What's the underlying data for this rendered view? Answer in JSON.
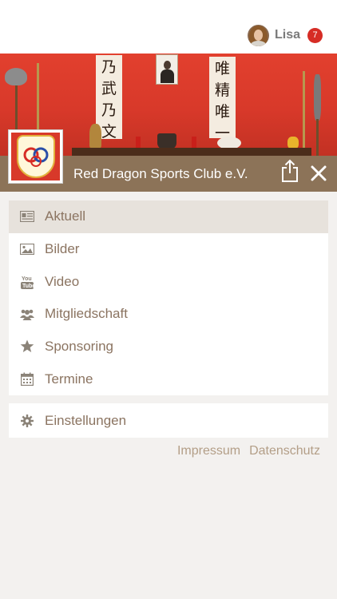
{
  "user": {
    "name": "Lisa",
    "notification_count": "7"
  },
  "hero": {
    "scroll_left": [
      "乃",
      "武",
      "乃",
      "文"
    ],
    "scroll_right": [
      "唯",
      "精",
      "唯",
      "一"
    ]
  },
  "club": {
    "title": "Red Dragon Sports Club e.V."
  },
  "menu": {
    "items": [
      {
        "label": "Aktuell",
        "icon": "newspaper-icon",
        "active": true
      },
      {
        "label": "Bilder",
        "icon": "image-icon",
        "active": false
      },
      {
        "label": "Video",
        "icon": "youtube-icon",
        "active": false
      },
      {
        "label": "Mitgliedschaft",
        "icon": "users-icon",
        "active": false
      },
      {
        "label": "Sponsoring",
        "icon": "star-icon",
        "active": false
      },
      {
        "label": "Termine",
        "icon": "calendar-icon",
        "active": false
      }
    ]
  },
  "settings": {
    "label": "Einstellungen",
    "icon": "gear-icon"
  },
  "footer": {
    "impressum": "Impressum",
    "datenschutz": "Datenschutz"
  },
  "colors": {
    "accent": "#8c7358",
    "text_brown": "#8b7461",
    "active_bg": "#e7e2dc",
    "badge_red": "#d62c25",
    "background": "#f3f1ef"
  }
}
